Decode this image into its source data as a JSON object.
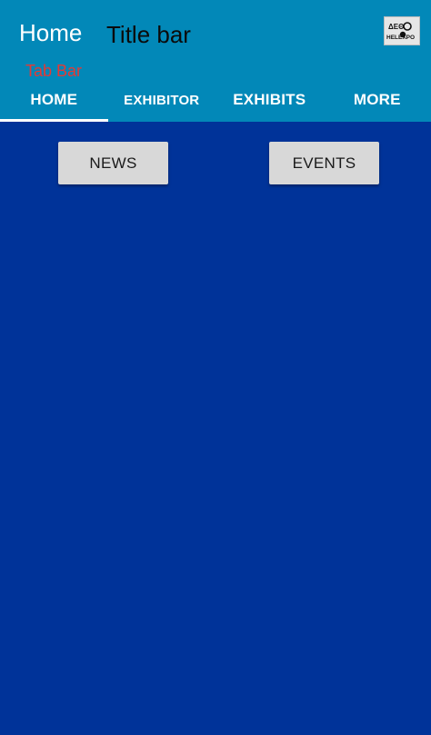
{
  "appbar": {
    "screen_title": "Home",
    "titlebar_text": "Title bar",
    "logo": {
      "icon": "helexpo-logo-icon",
      "text_top": "ΔΕΘ",
      "text_bottom": "HELEXPO"
    },
    "tabbar_caption": "Tab Bar",
    "tabs": [
      {
        "label": "HOME",
        "active": true
      },
      {
        "label": "EXHIBITOR",
        "active": false
      },
      {
        "label": "EXHIBITS",
        "active": false
      },
      {
        "label": "MORE",
        "active": false
      }
    ]
  },
  "main": {
    "news_label": "NEWS",
    "events_label": "EVENTS"
  },
  "colors": {
    "appbar": "#0288b8",
    "content_background": "#003399",
    "tabbar_caption": "#e53935",
    "button": "#d8d8d8"
  }
}
